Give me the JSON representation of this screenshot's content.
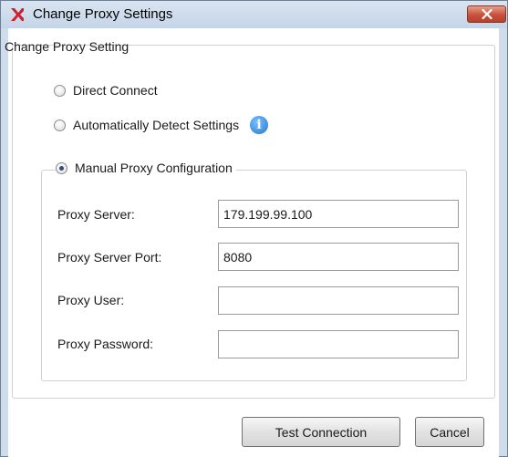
{
  "window": {
    "title": "Change Proxy Settings",
    "close_glyph": "✕"
  },
  "group": {
    "title": "Change Proxy Setting"
  },
  "options": {
    "direct": "Direct Connect",
    "auto": "Automatically Detect Settings",
    "manual": "Manual Proxy Configuration",
    "selected": "manual"
  },
  "fields": {
    "server_label": "Proxy Server:",
    "server_value": "179.199.99.100",
    "port_label": "Proxy Server Port:",
    "port_value": "8080",
    "user_label": "Proxy User:",
    "user_value": "",
    "password_label": "Proxy Password:",
    "password_value": ""
  },
  "buttons": {
    "test": "Test Connection",
    "cancel": "Cancel"
  },
  "icons": {
    "app": "xilinx-logo-icon",
    "info": "info-icon",
    "close": "close-icon"
  },
  "colors": {
    "titlebar": "#c5d5e8",
    "close_button": "#c9503a",
    "info_icon": "#1f78d1"
  }
}
